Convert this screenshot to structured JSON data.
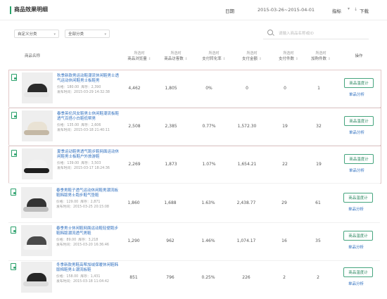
{
  "header": {
    "title": "商品效果明细",
    "date_label": "日期",
    "date_range": "2015-03-26~2015-04-01",
    "metric_label": "指标",
    "download_label": "下载"
  },
  "filters": {
    "select1": "自定义分类",
    "select2": "全部分类",
    "search_placeholder": "请输入商品名称或ID"
  },
  "table": {
    "columns": [
      {
        "label": "商品名称",
        "sub": ""
      },
      {
        "label": "商品浏览量",
        "sub": "所选时"
      },
      {
        "label": "商品访客数",
        "sub": "所选时"
      },
      {
        "label": "支付转化率",
        "sub": "所选时"
      },
      {
        "label": "支付金额",
        "sub": "所选时"
      },
      {
        "label": "支付件数",
        "sub": "所选时"
      },
      {
        "label": "加购件数",
        "sub": "所选时"
      },
      {
        "label": "操作",
        "sub": ""
      }
    ],
    "rows": [
      {
        "name": "秋季新款男运动鞋潮流休闲鞋男士透气运动休闲鞋男士板鞋男",
        "price": "价格：180.00",
        "stock": "库存：2,390",
        "pub": "发布时间：2015-03-29 14:32:38",
        "views": "4,462",
        "visitors": "1,805",
        "cvr": "0%",
        "amount": "0",
        "units": "0",
        "cart": "1",
        "shoe_colors": [
          "#2a2a2a",
          "#e8e8e8"
        ]
      },
      {
        "name": "春季英伦风女鞋男士休闲鞋潮流板鞋透气百搭小白鞋低帮男",
        "price": "价格：135.00",
        "stock": "库存：2,606",
        "pub": "发布时间：2015-03-18 21:40:11",
        "views": "2,508",
        "visitors": "2,385",
        "cvr": "0.77%",
        "amount": "1,572.30",
        "units": "19",
        "cart": "32",
        "shoe_colors": [
          "#e9e2d4",
          "#c4b8a5"
        ]
      },
      {
        "name": "夏季运动鞋男透气跑步鞋网面运动休闲鞋男士板鞋户外旅游鞋",
        "price": "价格：139.00",
        "stock": "库存：3,503",
        "pub": "发布时间：2015-03-17 18:24:36",
        "views": "2,269",
        "visitors": "1,873",
        "cvr": "1.07%",
        "amount": "1,654.21",
        "units": "22",
        "cart": "19",
        "shoe_colors": [
          "#f2f2f2",
          "#1f1f1f"
        ]
      },
      {
        "name": "春季男鞋子透气运动休闲鞋男潮流板鞋韩版男士跑步鞋气垫鞋",
        "price": "价格：129.00",
        "stock": "库存：2,871",
        "pub": "发布时间：2015-03-25 20:15:08",
        "views": "1,860",
        "visitors": "1,688",
        "cvr": "1.63%",
        "amount": "2,438.77",
        "units": "29",
        "cart": "61",
        "shoe_colors": [
          "#333333",
          "#bdbdbd"
        ]
      },
      {
        "name": "春季男士休闲鞋网面运动鞋轻便跑步鞋韩版潮流透气男鞋",
        "price": "价格：89.00",
        "stock": "库存：3,218",
        "pub": "发布时间：2015-03-20 16:36:46",
        "views": "1,290",
        "visitors": "962",
        "cvr": "1.46%",
        "amount": "1,074.17",
        "units": "16",
        "cart": "35",
        "shoe_colors": [
          "#4a4a4a",
          "#f5f5f5"
        ]
      },
      {
        "name": "冬季新款男鞋高帮加绒保暖休闲鞋韩版棉鞋男士潮流板鞋",
        "price": "价格：158.00",
        "stock": "库存：1,431",
        "pub": "发布时间：2015-03-18 11:04:42",
        "views": "851",
        "visitors": "796",
        "cvr": "0.25%",
        "amount": "226",
        "units": "2",
        "cart": "2",
        "shoe_colors": [
          "#262626",
          "#dcdcdc"
        ]
      }
    ],
    "action_primary": "商品温度计",
    "action_secondary": "单品分析"
  }
}
